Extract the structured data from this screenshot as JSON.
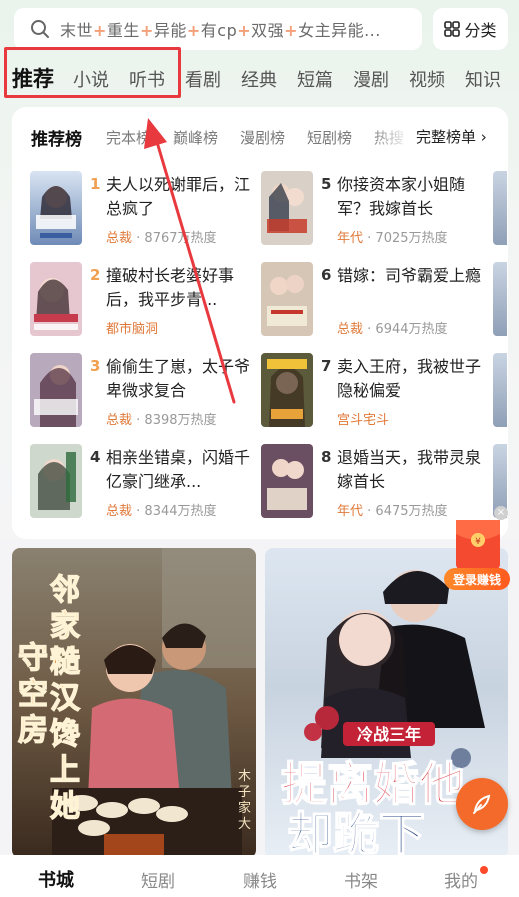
{
  "search": {
    "placeholder_parts": [
      "末世",
      "重生",
      "异能",
      "有cp",
      "双强",
      "女主异能..."
    ],
    "category_label": "分类"
  },
  "nav_tabs": [
    {
      "label": "推荐",
      "active": true
    },
    {
      "label": "小说",
      "active": false
    },
    {
      "label": "听书",
      "active": false
    },
    {
      "label": "看剧",
      "active": false
    },
    {
      "label": "经典",
      "active": false
    },
    {
      "label": "短篇",
      "active": false
    },
    {
      "label": "漫剧",
      "active": false
    },
    {
      "label": "视频",
      "active": false
    },
    {
      "label": "知识",
      "active": false
    }
  ],
  "ranking": {
    "tabs": [
      {
        "label": "推荐榜",
        "active": true
      },
      {
        "label": "完本榜",
        "active": false
      },
      {
        "label": "巅峰榜",
        "active": false
      },
      {
        "label": "漫剧榜",
        "active": false
      },
      {
        "label": "短剧榜",
        "active": false
      },
      {
        "label": "热搜",
        "active": false
      }
    ],
    "full_list_label": "完整榜单 ›",
    "books": [
      {
        "rank": "1",
        "title": "夫人以死谢罪后，江总疯了",
        "tag": "总裁",
        "heat": "8767万热度"
      },
      {
        "rank": "2",
        "title": "撞破村长老婆好事后，我平步青...",
        "tag": "都市脑洞",
        "heat": ""
      },
      {
        "rank": "3",
        "title": "偷偷生了崽，太子爷卑微求复合",
        "tag": "总裁",
        "heat": "8398万热度"
      },
      {
        "rank": "4",
        "title": "相亲坐错桌，闪婚千亿豪门继承...",
        "tag": "总裁",
        "heat": "8344万热度"
      },
      {
        "rank": "5",
        "title": "你接资本家小姐随军？我嫁首长",
        "tag": "年代",
        "heat": "7025万热度"
      },
      {
        "rank": "6",
        "title": "错嫁：司爷霸爱上瘾",
        "tag": "总裁",
        "heat": "6944万热度"
      },
      {
        "rank": "7",
        "title": "卖入王府，我被世子隐秘偏爱",
        "tag": "宫斗宅斗",
        "heat": ""
      },
      {
        "rank": "8",
        "title": "退婚当天，我带灵泉嫁首长",
        "tag": "年代",
        "heat": "6475万热度"
      }
    ]
  },
  "featured": [
    {
      "cover_text": "邻家糙汉馋上她守空房",
      "author": "木子家大"
    },
    {
      "cover_text_small": "冷战三年",
      "cover_text_big": "提离婚他却跪下"
    }
  ],
  "reward_widget": {
    "label": "登录赚钱"
  },
  "bottom_nav": [
    {
      "label": "书城",
      "active": true
    },
    {
      "label": "短剧",
      "active": false
    },
    {
      "label": "赚钱",
      "active": false
    },
    {
      "label": "书架",
      "active": false
    },
    {
      "label": "我的",
      "active": false
    }
  ],
  "colors": {
    "accent": "#e07a3a",
    "highlight_box": "#e8393f",
    "rank_top": "#f0a050"
  }
}
